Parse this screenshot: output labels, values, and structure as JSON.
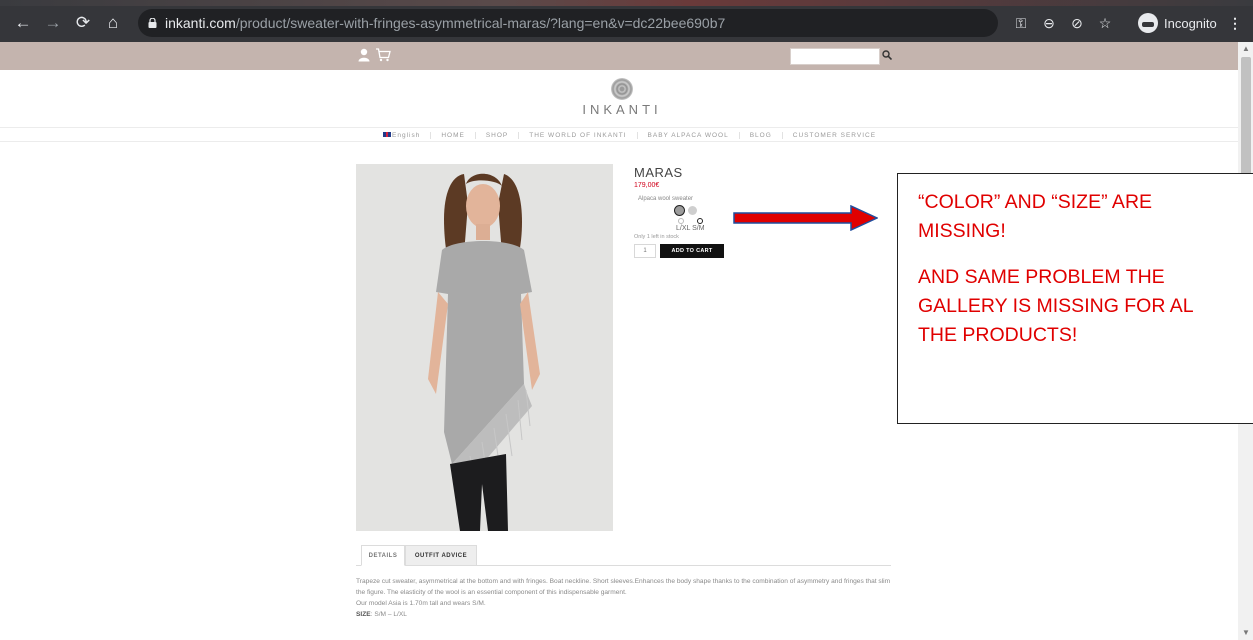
{
  "browser": {
    "url_host": "inkanti.com",
    "url_path": "/product/sweater-with-fringes-asymmetrical-maras/?lang=en&v=dc22bee690b7",
    "incognito_label": "Incognito"
  },
  "menu": {
    "items": [
      "English",
      "HOME",
      "SHOP",
      "THE WORLD OF INKANTI",
      "BABY ALPACA WOOL",
      "BLOG",
      "CUSTOMER SERVICE"
    ]
  },
  "logo": {
    "text": "INKANTI"
  },
  "product": {
    "title": "MARAS",
    "price": "179,00€",
    "subtitle": "Alpaca wool sweater",
    "sizes_label": "L/XL S/M",
    "stock_text": "Only 1 left in stock",
    "qty": "1",
    "add_to_cart": "ADD TO CART"
  },
  "annotation": {
    "line1": "“COLOR” AND “SIZE” ARE MISSING!",
    "line2a": "AND SAME PROBLEM THE",
    "line2b": "GALLERY IS MISSING FOR AL",
    "line2c": "THE PRODUCTS!"
  },
  "tabs": {
    "details": "DETAILS",
    "outfit": "OUTFIT ADVICE"
  },
  "description": {
    "para1": "Trapeze cut sweater, asymmetrical at the bottom and with fringes. Boat neckline. Short sleeves.Enhances the body shape thanks to the combination of asymmetry and fringes that slim the figure. The elasticity of the wool is an essential component of this indispensable garment.",
    "para2": "Our model Asia is 1.70m tall and wears S/M.",
    "size_label": "SIZE",
    "size_value": ": S/M – L/XL"
  },
  "colors": {
    "chrome_bg": "#35363a",
    "topbar": "#c4b4ae",
    "price_red": "#d0021b",
    "annotation_red": "#e00000",
    "arrow_fill": "#e00000",
    "arrow_border": "#1f4e9e"
  },
  "icons": [
    "back-arrow-icon",
    "forward-arrow-icon",
    "reload-icon",
    "home-icon",
    "lock-icon",
    "key-icon",
    "zoom-icon",
    "eye-off-icon",
    "star-icon",
    "incognito-icon",
    "kebab-menu-icon",
    "user-icon",
    "cart-icon",
    "search-icon"
  ]
}
